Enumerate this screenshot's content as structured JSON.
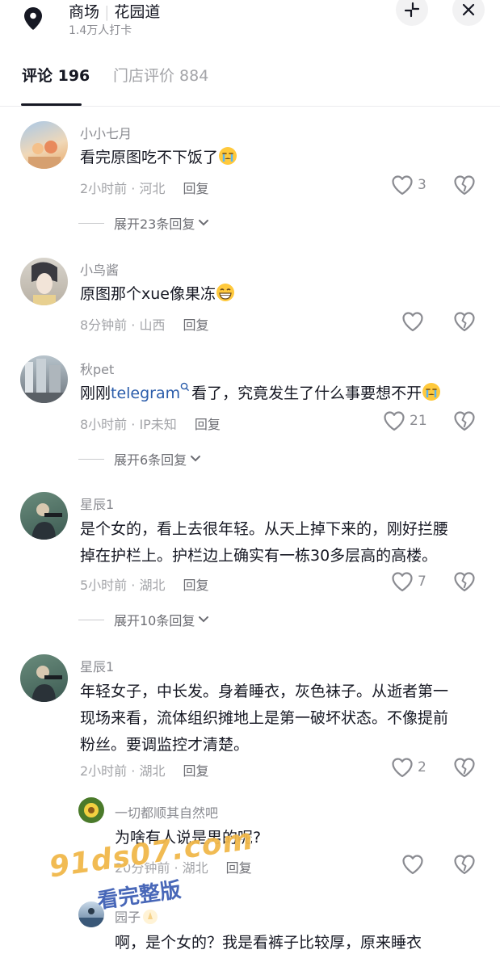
{
  "header": {
    "title_part1": "商场",
    "title_part2": "花园道",
    "checkins": "1.4万人打卡"
  },
  "tabs": {
    "comments": "评论 196",
    "reviews": "门店评价 884"
  },
  "comments": [
    {
      "username": "小小七月",
      "text": "看完原图吃不下饭了",
      "emoji": "crying-emoji",
      "time_location": "2小时前 · 河北",
      "reply": "回复",
      "likes": "3",
      "expand": "展开23条回复"
    },
    {
      "username": "小鸟酱",
      "text": "原图那个xue像果冻",
      "emoji": "grin-emoji",
      "time_location": "8分钟前 · 山西",
      "reply": "回复",
      "likes": ""
    },
    {
      "username": "秋pet",
      "text_before": "刚刚",
      "link": "telegram",
      "text_after": "看了，究竟发生了什么事要想不开",
      "emoji": "crying-emoji",
      "time_location": "8小时前 · IP未知",
      "reply": "回复",
      "likes": "21",
      "expand": "展开6条回复"
    },
    {
      "username": "星辰1",
      "text_line1": "是个女的，看上去很年轻。从天上掉下来的，刚好拦腰",
      "text_line2": "掉在护栏上。护栏边上确实有一栋30多层高的高楼。",
      "time_location": "5小时前 · 湖北",
      "reply": "回复",
      "likes": "7",
      "expand": "展开10条回复"
    },
    {
      "username": "星辰1",
      "text_line1": "年轻女子，中长发。身着睡衣，灰色袜子。从逝者第一",
      "text_line2": "现场来看，流体组织摊地上是第一破坏状态。不像提前",
      "text_line3": "粉丝。要调监控才清楚。",
      "time_location": "2小时前 · 湖北",
      "reply": "回复",
      "likes": "2"
    }
  ],
  "replies": [
    {
      "username": "一切都顺其自然吧",
      "text": "为啥有人说是男的呢?",
      "time_location": "20分钟前 · 湖北",
      "reply": "回复"
    },
    {
      "username": "园子",
      "text": "啊，是个女的？我是看裤子比较厚，原来睡衣"
    }
  ],
  "watermark": {
    "line1": "91ds07.com",
    "line2": "看完整版"
  },
  "colors": {
    "text": "#161823",
    "secondary": "#8a8b91",
    "link": "#2a5caa",
    "watermark_orange": "#f1b84a",
    "watermark_blue": "#3f5fb5"
  }
}
